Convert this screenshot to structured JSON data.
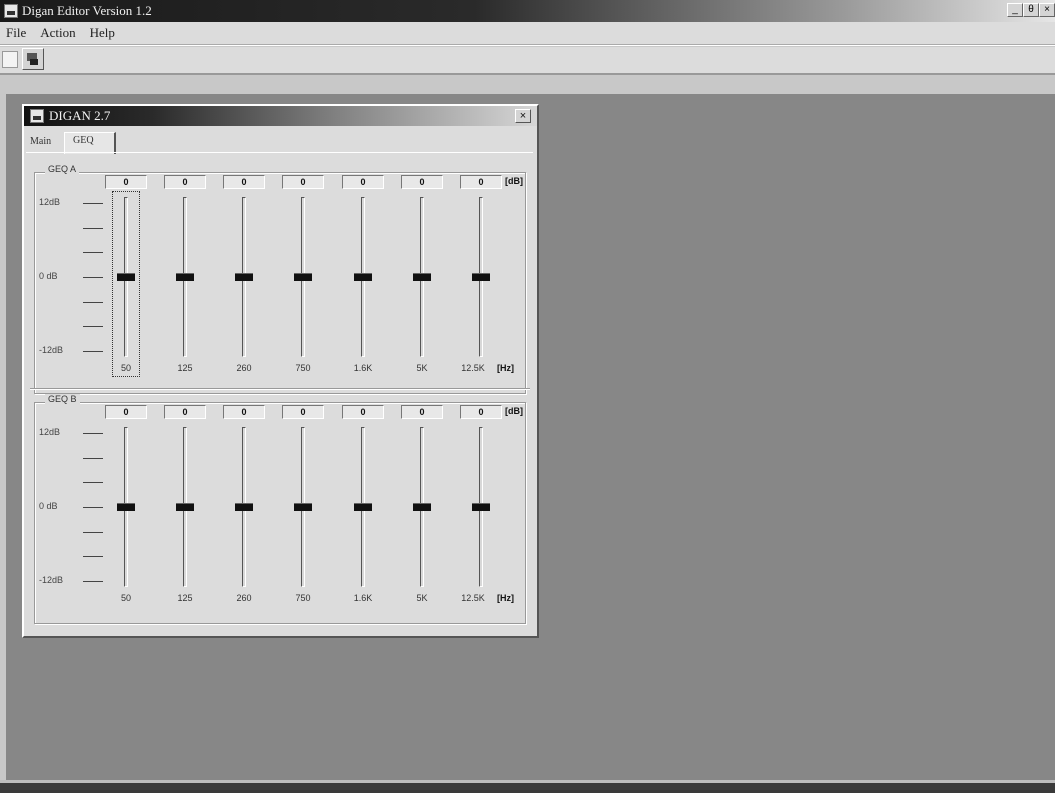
{
  "app": {
    "title": "Digan Editor Version 1.2",
    "controls": [
      "_",
      "θ",
      "×"
    ]
  },
  "menu": [
    "File",
    "Action",
    "Help"
  ],
  "toolbar": {
    "new_icon": "document-icon",
    "print_icon": "print-icon"
  },
  "child": {
    "title": "DIGAN 2.7",
    "close": "×",
    "tabs": [
      "Main",
      "GEQ"
    ],
    "active_tab": "GEQ"
  },
  "geq_a": {
    "label": "GEQ A",
    "scale": [
      "12dB",
      "0 dB",
      "-12dB"
    ],
    "unit_db": "[dB]",
    "values": [
      "0",
      "0",
      "0",
      "0",
      "0",
      "0",
      "0"
    ],
    "levels_db": [
      0,
      0,
      0,
      0,
      0,
      0,
      0
    ],
    "freqs": [
      "50",
      "125",
      "260",
      "750",
      "1.6K",
      "5K",
      "12.5K"
    ],
    "unit_hz": "[Hz]"
  },
  "geq_b": {
    "label": "GEQ B",
    "scale": [
      "12dB",
      "0 dB",
      "-12dB"
    ],
    "unit_db": "[dB]",
    "values": [
      "0",
      "0",
      "0",
      "0",
      "0",
      "0",
      "0"
    ],
    "levels_db": [
      0,
      0,
      0,
      0,
      0,
      0,
      0
    ],
    "freqs": [
      "50",
      "125",
      "260",
      "750",
      "1.6K",
      "5K",
      "12.5K"
    ],
    "unit_hz": "[Hz]"
  }
}
